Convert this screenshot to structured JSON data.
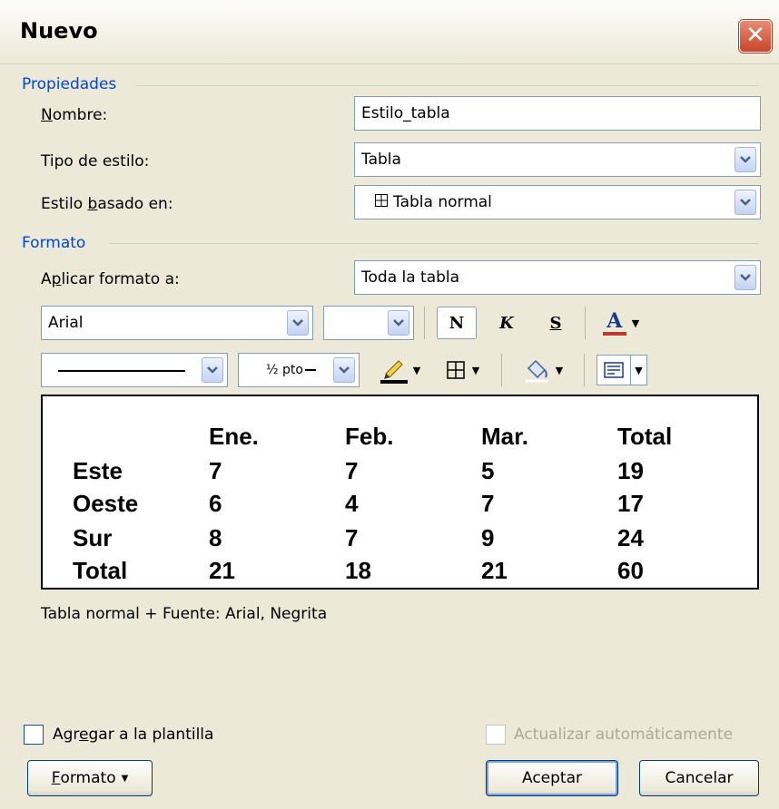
{
  "window": {
    "title": "Nuevo",
    "close_icon": "close-icon"
  },
  "propiedades": {
    "group_label": "Propiedades",
    "nombre": {
      "label_pre": "",
      "label_u": "N",
      "label_post": "ombre:",
      "value": "Estilo_tabla"
    },
    "tipo": {
      "label": "Tipo de estilo:",
      "value": "Tabla"
    },
    "basado": {
      "label_pre": "Estilo ",
      "label_u": "b",
      "label_post": "asado en:",
      "value": "Tabla normal",
      "icon": "table-grid-icon"
    }
  },
  "formato": {
    "group_label": "Formato",
    "aplicar": {
      "label_pre": "A",
      "label_u": "p",
      "label_post": "licar formato a:",
      "value": "Toda la tabla"
    },
    "font": {
      "name": "Arial",
      "size": ""
    },
    "bold_label": "N",
    "italic_label": "K",
    "underline_label": "S",
    "font_color_label": "A",
    "font_color": "#c0392b",
    "line_weight": "½ pto",
    "highlight_color": "#000000"
  },
  "preview_table": {
    "headers": [
      "",
      "Ene.",
      "Feb.",
      "Mar.",
      "Total"
    ],
    "rows": [
      [
        "Este",
        "7",
        "7",
        "5",
        "19"
      ],
      [
        "Oeste",
        "6",
        "4",
        "7",
        "17"
      ],
      [
        "Sur",
        "8",
        "7",
        "9",
        "24"
      ],
      [
        "Total",
        "21",
        "18",
        "21",
        "60"
      ]
    ]
  },
  "description": "Tabla normal + Fuente: Arial, Negrita",
  "options": {
    "agregar": {
      "label_pre": "Agr",
      "label_u": "e",
      "label_post": "gar a la plantilla",
      "checked": false
    },
    "actualizar": {
      "label": "Actualizar automáticamente",
      "checked": false,
      "enabled": false
    }
  },
  "buttons": {
    "formato": {
      "label_u": "F",
      "label_post": "ormato"
    },
    "aceptar": "Aceptar",
    "cancelar": "Cancelar"
  }
}
